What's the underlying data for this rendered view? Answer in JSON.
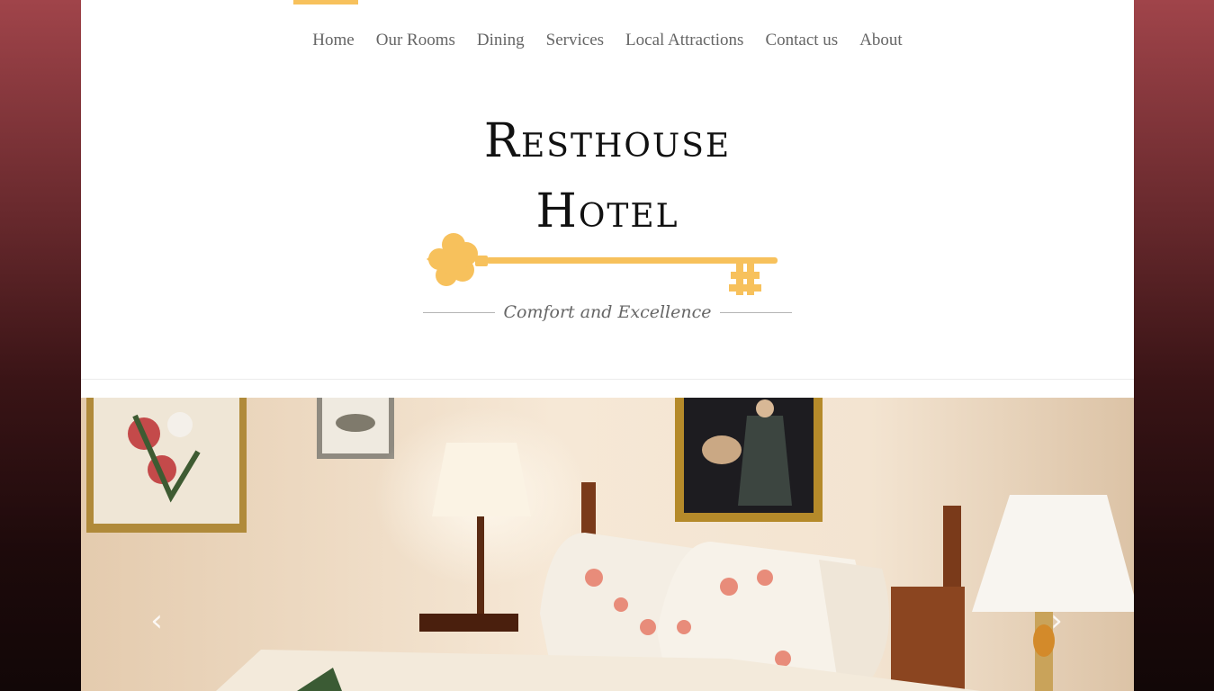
{
  "nav": {
    "items": [
      {
        "label": "Home",
        "active": true
      },
      {
        "label": "Our Rooms"
      },
      {
        "label": "Dining"
      },
      {
        "label": "Services"
      },
      {
        "label": "Local Attractions"
      },
      {
        "label": "Contact us"
      },
      {
        "label": "About"
      }
    ]
  },
  "brand": {
    "line1": "Resthouse",
    "line2": "Hotel",
    "tagline": "Comfort and Excellence",
    "accent_color": "#f7c15c"
  },
  "slider": {
    "prev_icon": "chevron-left-icon",
    "next_icon": "chevron-right-icon"
  }
}
